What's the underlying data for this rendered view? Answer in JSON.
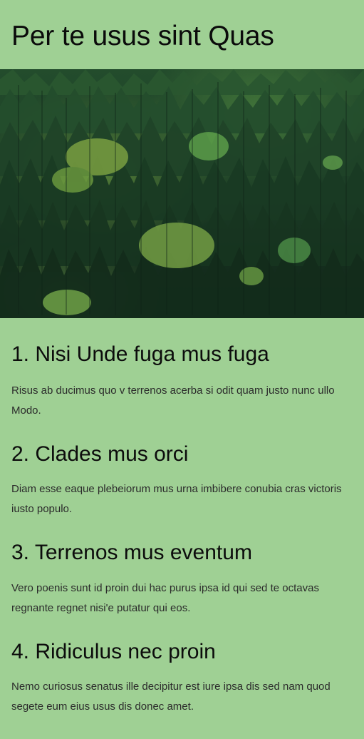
{
  "header": {
    "title": "Per te usus sint Quas"
  },
  "hero": {
    "subject": "aerial-forest-photo"
  },
  "sections": [
    {
      "title": "1. Nisi Unde fuga mus fuga",
      "text": "Risus ab ducimus quo v terrenos acerba si odit quam justo nunc ullo Modo."
    },
    {
      "title": "2. Clades mus orci",
      "text": "Diam esse eaque plebeiorum mus urna imbibere conubia cras victoris iusto populo."
    },
    {
      "title": "3. Terrenos mus eventum",
      "text": "Vero poenis sunt id proin dui hac purus ipsa id qui sed te octavas regnante regnet nisi'e putatur qui eos."
    },
    {
      "title": "4. Ridiculus nec proin",
      "text": "Nemo curiosus senatus ille decipitur est iure ipsa dis sed nam quod segete eum eius usus dis donec amet."
    }
  ],
  "colors": {
    "background": "#9fd094",
    "heading_text": "#0c0c0c",
    "body_text": "#2b2b2b"
  }
}
